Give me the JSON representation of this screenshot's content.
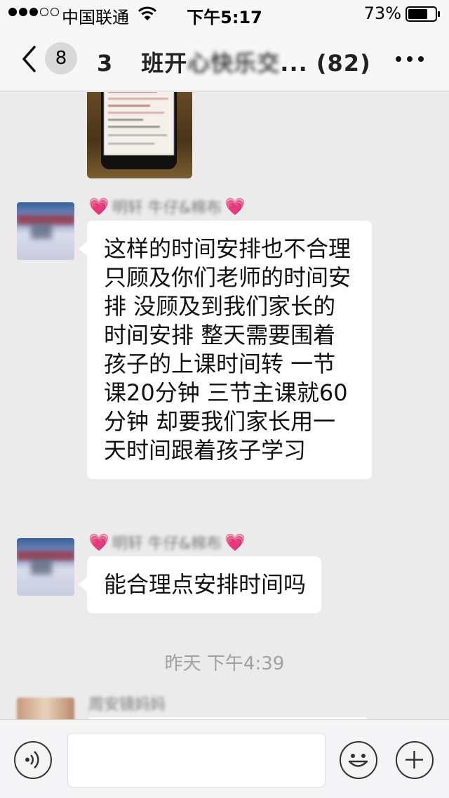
{
  "status_bar": {
    "carrier": "中国联通",
    "time": "下午5:17",
    "battery": "73%",
    "battery_level": 0.73
  },
  "nav": {
    "unread": "8",
    "title_prefix": "3",
    "title_main": "班开",
    "title_blurred": "心快乐交",
    "title_suffix": "... (82)"
  },
  "messages": [
    {
      "sender": "明轩 牛仔&棉布",
      "text": "这样的时间安排也不合理 只顾及你们老师的时间安排 没顾及到我们家长的时间安排 整天需要围着孩子的上课时间转 一节课20分钟 三节主课就60分钟 却要我们家长用一天时间跟着孩子学习"
    },
    {
      "sender": "明轩 牛仔&棉布",
      "text": "能合理点安排时间吗"
    }
  ],
  "time_separator": "昨天 下午4:39",
  "partial_sender": "周安镜妈妈",
  "input": {
    "value": "",
    "placeholder": ""
  }
}
